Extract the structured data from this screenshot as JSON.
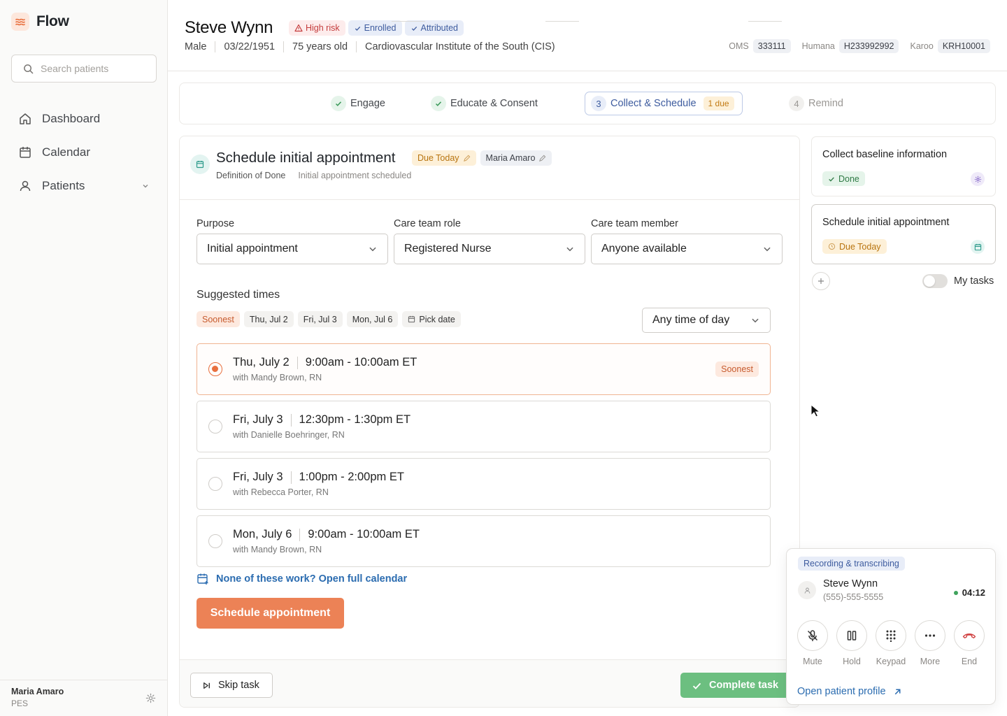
{
  "app": {
    "name": "Flow"
  },
  "search": {
    "placeholder": "Search patients"
  },
  "nav": [
    {
      "label": "Dashboard",
      "icon": "home-icon"
    },
    {
      "label": "Calendar",
      "icon": "calendar-icon"
    },
    {
      "label": "Patients",
      "icon": "user-icon"
    }
  ],
  "user": {
    "name": "Maria Amaro",
    "role": "PES"
  },
  "patient": {
    "name": "Steve Wynn",
    "tags": [
      "High risk",
      "Enrolled",
      "Attributed"
    ],
    "sex": "Male",
    "dob": "03/22/1951",
    "age": "75 years old",
    "practice": "Cardiovascular Institute of the South (CIS)",
    "ids": [
      {
        "label": "OMS",
        "value": "333111"
      },
      {
        "label": "Humana",
        "value": "H233992992"
      },
      {
        "label": "Karoo",
        "value": "KRH10001"
      }
    ]
  },
  "stepper": {
    "steps": [
      {
        "label": "Engage",
        "state": "done"
      },
      {
        "label": "Educate & Consent",
        "state": "done"
      },
      {
        "number": "3",
        "label": "Collect & Schedule",
        "state": "active",
        "badge": "1 due"
      },
      {
        "number": "4",
        "label": "Remind",
        "state": "upcoming"
      }
    ]
  },
  "task": {
    "title": "Schedule initial appointment",
    "due": "Due Today",
    "assignee": "Maria Amaro",
    "dod_label": "Definition of Done",
    "dod_value": "Initial appointment scheduled"
  },
  "form": {
    "purpose": {
      "label": "Purpose",
      "value": "Initial appointment"
    },
    "role": {
      "label": "Care team role",
      "value": "Registered Nurse"
    },
    "member": {
      "label": "Care team member",
      "value": "Anyone available"
    }
  },
  "suggested": {
    "title": "Suggested times",
    "filters": [
      "Soonest",
      "Thu, Jul 2",
      "Fri, Jul 3",
      "Mon, Jul 6"
    ],
    "pick_date": "Pick date",
    "time_of_day": "Any time of day",
    "slots": [
      {
        "date": "Thu, July 2",
        "time": "9:00am - 10:00am ET",
        "with": "with Mandy Brown, RN",
        "badge": "Soonest",
        "selected": true
      },
      {
        "date": "Fri, July 3",
        "time": "12:30pm - 1:30pm ET",
        "with": "with Danielle Boehringer, RN",
        "selected": false
      },
      {
        "date": "Fri, July 3",
        "time": "1:00pm - 2:00pm ET",
        "with": "with Rebecca Porter, RN",
        "selected": false
      },
      {
        "date": "Mon, July 6",
        "time": "9:00am - 10:00am ET",
        "with": "with Mandy Brown, RN",
        "selected": false
      }
    ],
    "open_calendar": "None of these work? Open full calendar",
    "schedule_button": "Schedule appointment"
  },
  "footer": {
    "skip": "Skip task",
    "complete": "Complete task"
  },
  "task_list": [
    {
      "title": "Collect baseline information",
      "status": "Done"
    },
    {
      "title": "Schedule initial appointment",
      "status": "Due Today"
    }
  ],
  "my_tasks_label": "My tasks",
  "call": {
    "badge": "Recording & transcribing",
    "name": "Steve Wynn",
    "phone": "(555)-555-5555",
    "timer": "04:12",
    "controls": [
      "Mute",
      "Hold",
      "Keypad",
      "More",
      "End"
    ],
    "open_profile": "Open patient profile"
  },
  "colors": {
    "accent": "#ec8256",
    "success": "#6cbf80",
    "link": "#2b6cb0"
  }
}
